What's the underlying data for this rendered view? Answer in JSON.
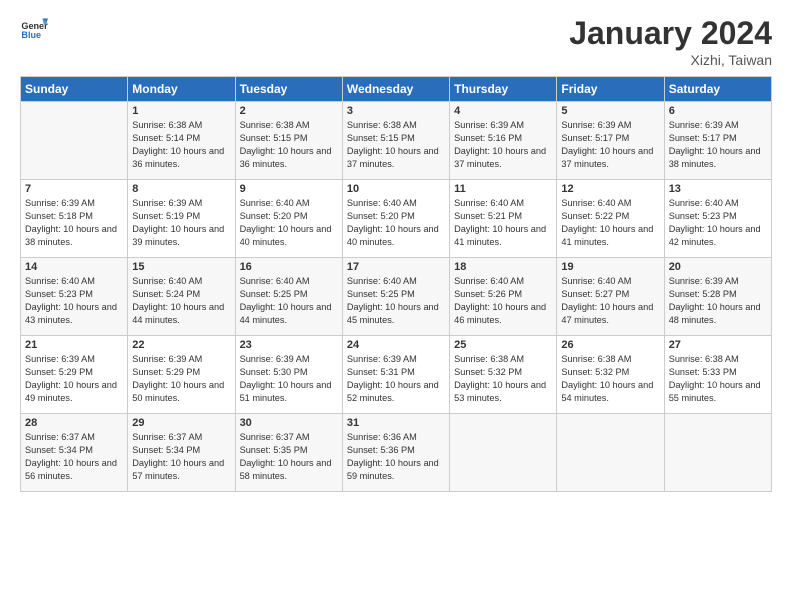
{
  "logo": {
    "general": "General",
    "blue": "Blue"
  },
  "title": "January 2024",
  "location": "Xizhi, Taiwan",
  "days_of_week": [
    "Sunday",
    "Monday",
    "Tuesday",
    "Wednesday",
    "Thursday",
    "Friday",
    "Saturday"
  ],
  "weeks": [
    [
      {
        "day": "",
        "sunrise": "",
        "sunset": "",
        "daylight": ""
      },
      {
        "day": "1",
        "sunrise": "6:38 AM",
        "sunset": "5:14 PM",
        "daylight": "10 hours and 36 minutes."
      },
      {
        "day": "2",
        "sunrise": "6:38 AM",
        "sunset": "5:15 PM",
        "daylight": "10 hours and 36 minutes."
      },
      {
        "day": "3",
        "sunrise": "6:38 AM",
        "sunset": "5:15 PM",
        "daylight": "10 hours and 37 minutes."
      },
      {
        "day": "4",
        "sunrise": "6:39 AM",
        "sunset": "5:16 PM",
        "daylight": "10 hours and 37 minutes."
      },
      {
        "day": "5",
        "sunrise": "6:39 AM",
        "sunset": "5:17 PM",
        "daylight": "10 hours and 37 minutes."
      },
      {
        "day": "6",
        "sunrise": "6:39 AM",
        "sunset": "5:17 PM",
        "daylight": "10 hours and 38 minutes."
      }
    ],
    [
      {
        "day": "7",
        "sunrise": "6:39 AM",
        "sunset": "5:18 PM",
        "daylight": "10 hours and 38 minutes."
      },
      {
        "day": "8",
        "sunrise": "6:39 AM",
        "sunset": "5:19 PM",
        "daylight": "10 hours and 39 minutes."
      },
      {
        "day": "9",
        "sunrise": "6:40 AM",
        "sunset": "5:20 PM",
        "daylight": "10 hours and 40 minutes."
      },
      {
        "day": "10",
        "sunrise": "6:40 AM",
        "sunset": "5:20 PM",
        "daylight": "10 hours and 40 minutes."
      },
      {
        "day": "11",
        "sunrise": "6:40 AM",
        "sunset": "5:21 PM",
        "daylight": "10 hours and 41 minutes."
      },
      {
        "day": "12",
        "sunrise": "6:40 AM",
        "sunset": "5:22 PM",
        "daylight": "10 hours and 41 minutes."
      },
      {
        "day": "13",
        "sunrise": "6:40 AM",
        "sunset": "5:23 PM",
        "daylight": "10 hours and 42 minutes."
      }
    ],
    [
      {
        "day": "14",
        "sunrise": "6:40 AM",
        "sunset": "5:23 PM",
        "daylight": "10 hours and 43 minutes."
      },
      {
        "day": "15",
        "sunrise": "6:40 AM",
        "sunset": "5:24 PM",
        "daylight": "10 hours and 44 minutes."
      },
      {
        "day": "16",
        "sunrise": "6:40 AM",
        "sunset": "5:25 PM",
        "daylight": "10 hours and 44 minutes."
      },
      {
        "day": "17",
        "sunrise": "6:40 AM",
        "sunset": "5:25 PM",
        "daylight": "10 hours and 45 minutes."
      },
      {
        "day": "18",
        "sunrise": "6:40 AM",
        "sunset": "5:26 PM",
        "daylight": "10 hours and 46 minutes."
      },
      {
        "day": "19",
        "sunrise": "6:40 AM",
        "sunset": "5:27 PM",
        "daylight": "10 hours and 47 minutes."
      },
      {
        "day": "20",
        "sunrise": "6:39 AM",
        "sunset": "5:28 PM",
        "daylight": "10 hours and 48 minutes."
      }
    ],
    [
      {
        "day": "21",
        "sunrise": "6:39 AM",
        "sunset": "5:29 PM",
        "daylight": "10 hours and 49 minutes."
      },
      {
        "day": "22",
        "sunrise": "6:39 AM",
        "sunset": "5:29 PM",
        "daylight": "10 hours and 50 minutes."
      },
      {
        "day": "23",
        "sunrise": "6:39 AM",
        "sunset": "5:30 PM",
        "daylight": "10 hours and 51 minutes."
      },
      {
        "day": "24",
        "sunrise": "6:39 AM",
        "sunset": "5:31 PM",
        "daylight": "10 hours and 52 minutes."
      },
      {
        "day": "25",
        "sunrise": "6:38 AM",
        "sunset": "5:32 PM",
        "daylight": "10 hours and 53 minutes."
      },
      {
        "day": "26",
        "sunrise": "6:38 AM",
        "sunset": "5:32 PM",
        "daylight": "10 hours and 54 minutes."
      },
      {
        "day": "27",
        "sunrise": "6:38 AM",
        "sunset": "5:33 PM",
        "daylight": "10 hours and 55 minutes."
      }
    ],
    [
      {
        "day": "28",
        "sunrise": "6:37 AM",
        "sunset": "5:34 PM",
        "daylight": "10 hours and 56 minutes."
      },
      {
        "day": "29",
        "sunrise": "6:37 AM",
        "sunset": "5:34 PM",
        "daylight": "10 hours and 57 minutes."
      },
      {
        "day": "30",
        "sunrise": "6:37 AM",
        "sunset": "5:35 PM",
        "daylight": "10 hours and 58 minutes."
      },
      {
        "day": "31",
        "sunrise": "6:36 AM",
        "sunset": "5:36 PM",
        "daylight": "10 hours and 59 minutes."
      },
      {
        "day": "",
        "sunrise": "",
        "sunset": "",
        "daylight": ""
      },
      {
        "day": "",
        "sunrise": "",
        "sunset": "",
        "daylight": ""
      },
      {
        "day": "",
        "sunrise": "",
        "sunset": "",
        "daylight": ""
      }
    ]
  ]
}
